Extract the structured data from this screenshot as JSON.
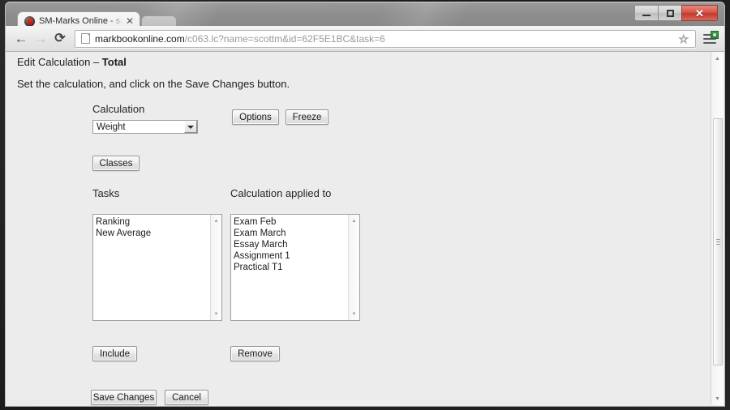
{
  "window": {
    "controls": {
      "minimize": "−",
      "maximize": "□",
      "close": "✕"
    }
  },
  "browser": {
    "tab": {
      "title": "SM-Marks Online - sampl",
      "close_label": "✕",
      "favicon": "marks-logo-icon"
    },
    "nav": {
      "back": "←",
      "forward": "→",
      "reload": "⟳"
    },
    "omnibox": {
      "host": "markbookonline.com",
      "path": "/c063.lc?name=scottm&id=62F5E1BC&task=6",
      "star": "☆"
    },
    "menu_badge": "update-available"
  },
  "page": {
    "title_prefix": "Edit Calculation – ",
    "title_value": "Total",
    "instruction": "Set the calculation, and click on the Save Changes button.",
    "calculation": {
      "label": "Calculation",
      "selected": "Weight"
    },
    "buttons": {
      "options": "Options",
      "freeze": "Freeze",
      "classes": "Classes",
      "include": "Include",
      "remove": "Remove",
      "save": "Save Changes",
      "cancel": "Cancel"
    },
    "tasks": {
      "label": "Tasks",
      "items": [
        "Ranking",
        "New Average"
      ]
    },
    "applied": {
      "label": "Calculation applied to",
      "items": [
        "Exam Feb",
        "Exam March",
        "Essay March",
        "Assignment 1",
        "Practical T1"
      ]
    }
  }
}
